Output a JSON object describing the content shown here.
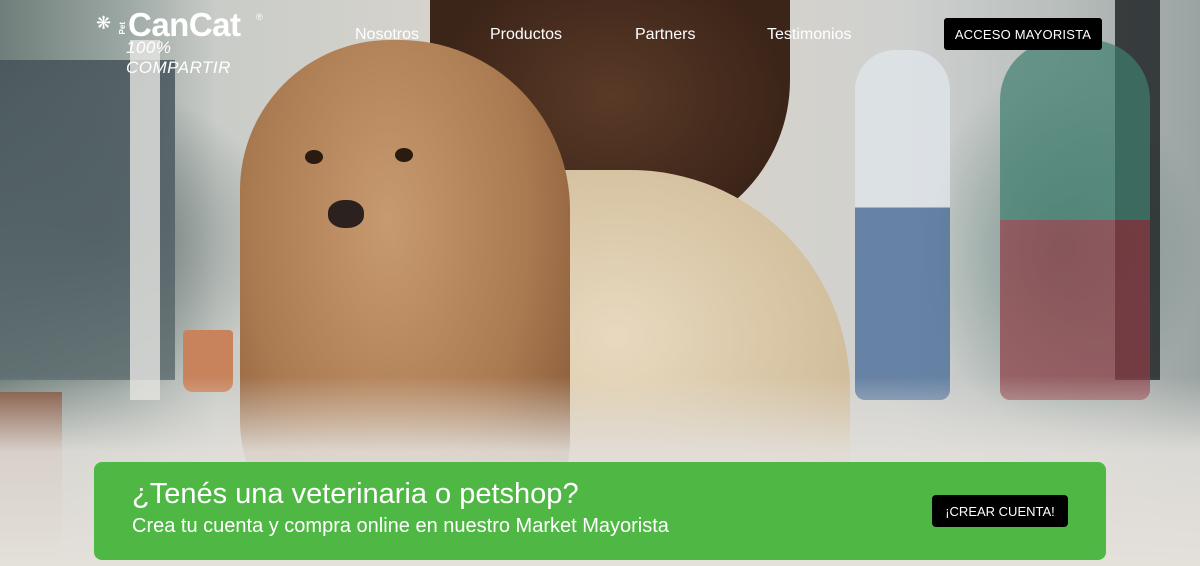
{
  "brand": {
    "pet_label": "Pet",
    "name": "CanCat",
    "registered": "®",
    "tagline": "100% COMPARTIR"
  },
  "nav": {
    "items": [
      {
        "label": "Nosotros"
      },
      {
        "label": "Productos"
      },
      {
        "label": "Partners"
      },
      {
        "label": "Testimonios"
      }
    ],
    "cta_label": "ACCESO MAYORISTA"
  },
  "banner": {
    "title": "¿Tenés una veterinaria o petshop?",
    "subtitle": "Crea tu cuenta y compra online en nuestro Market Mayorista",
    "button_label": "¡CREAR CUENTA!"
  },
  "colors": {
    "banner_green": "#4fb845",
    "button_black": "#000000",
    "text_white": "#ffffff"
  },
  "icons": {
    "logo_mark": "paw-icon"
  }
}
